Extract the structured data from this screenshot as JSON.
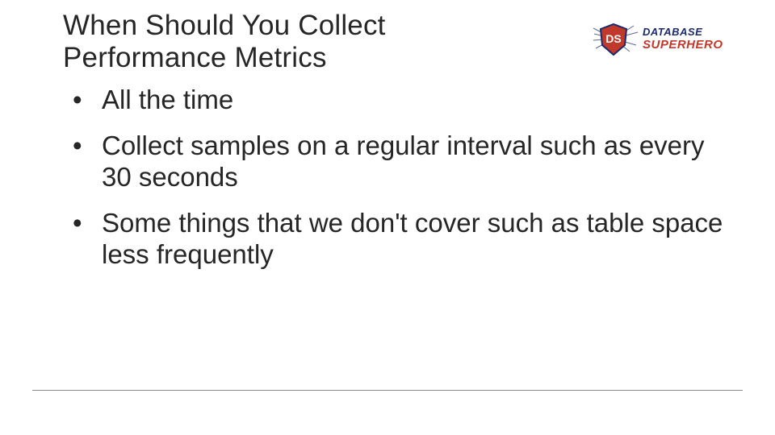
{
  "title": "When Should You Collect Performance Metrics",
  "bullets": [
    "All the time",
    "Collect samples on a regular interval such as every 30 seconds",
    "Some things that we don't cover such as table space less frequently"
  ],
  "logo": {
    "line1": "DATABASE",
    "line2": "SUPERHERO",
    "shield_text": "DS"
  }
}
